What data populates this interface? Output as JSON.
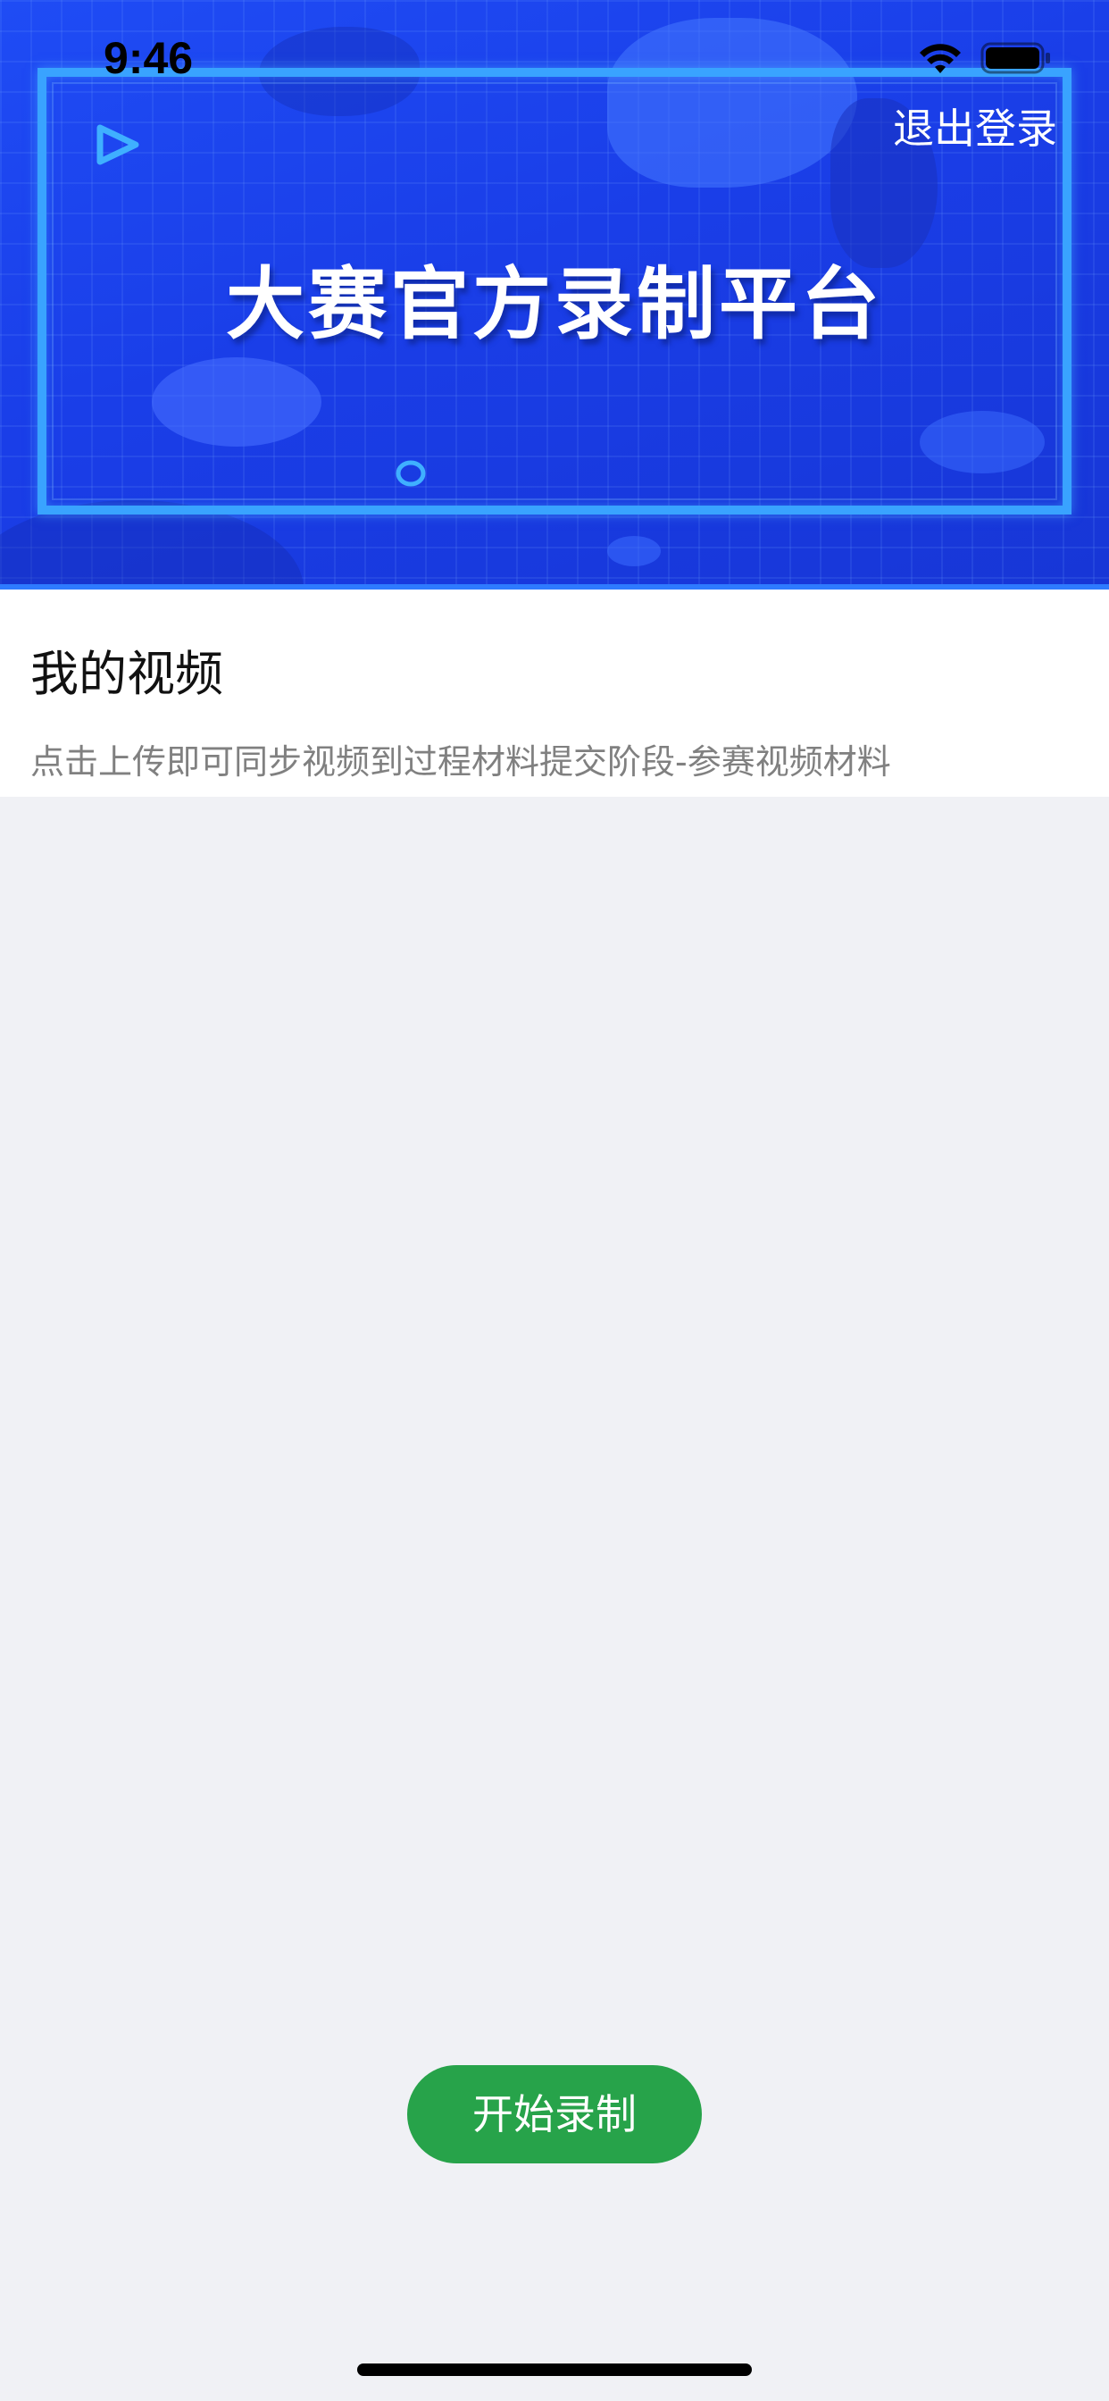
{
  "status_bar": {
    "time": "9:46",
    "icons": [
      "wifi-icon",
      "battery-icon"
    ]
  },
  "header": {
    "banner_title": "大赛官方录制平台",
    "logout_label": "退出登录",
    "colors": {
      "banner_blue": "#1a3ee8",
      "frame_cyan": "#39a3ff"
    }
  },
  "main": {
    "section_title": "我的视频",
    "section_description": "点击上传即可同步视频到过程材料提交阶段-参赛视频材料"
  },
  "footer": {
    "record_button_label": "开始录制",
    "record_button_color": "#27a34a"
  }
}
